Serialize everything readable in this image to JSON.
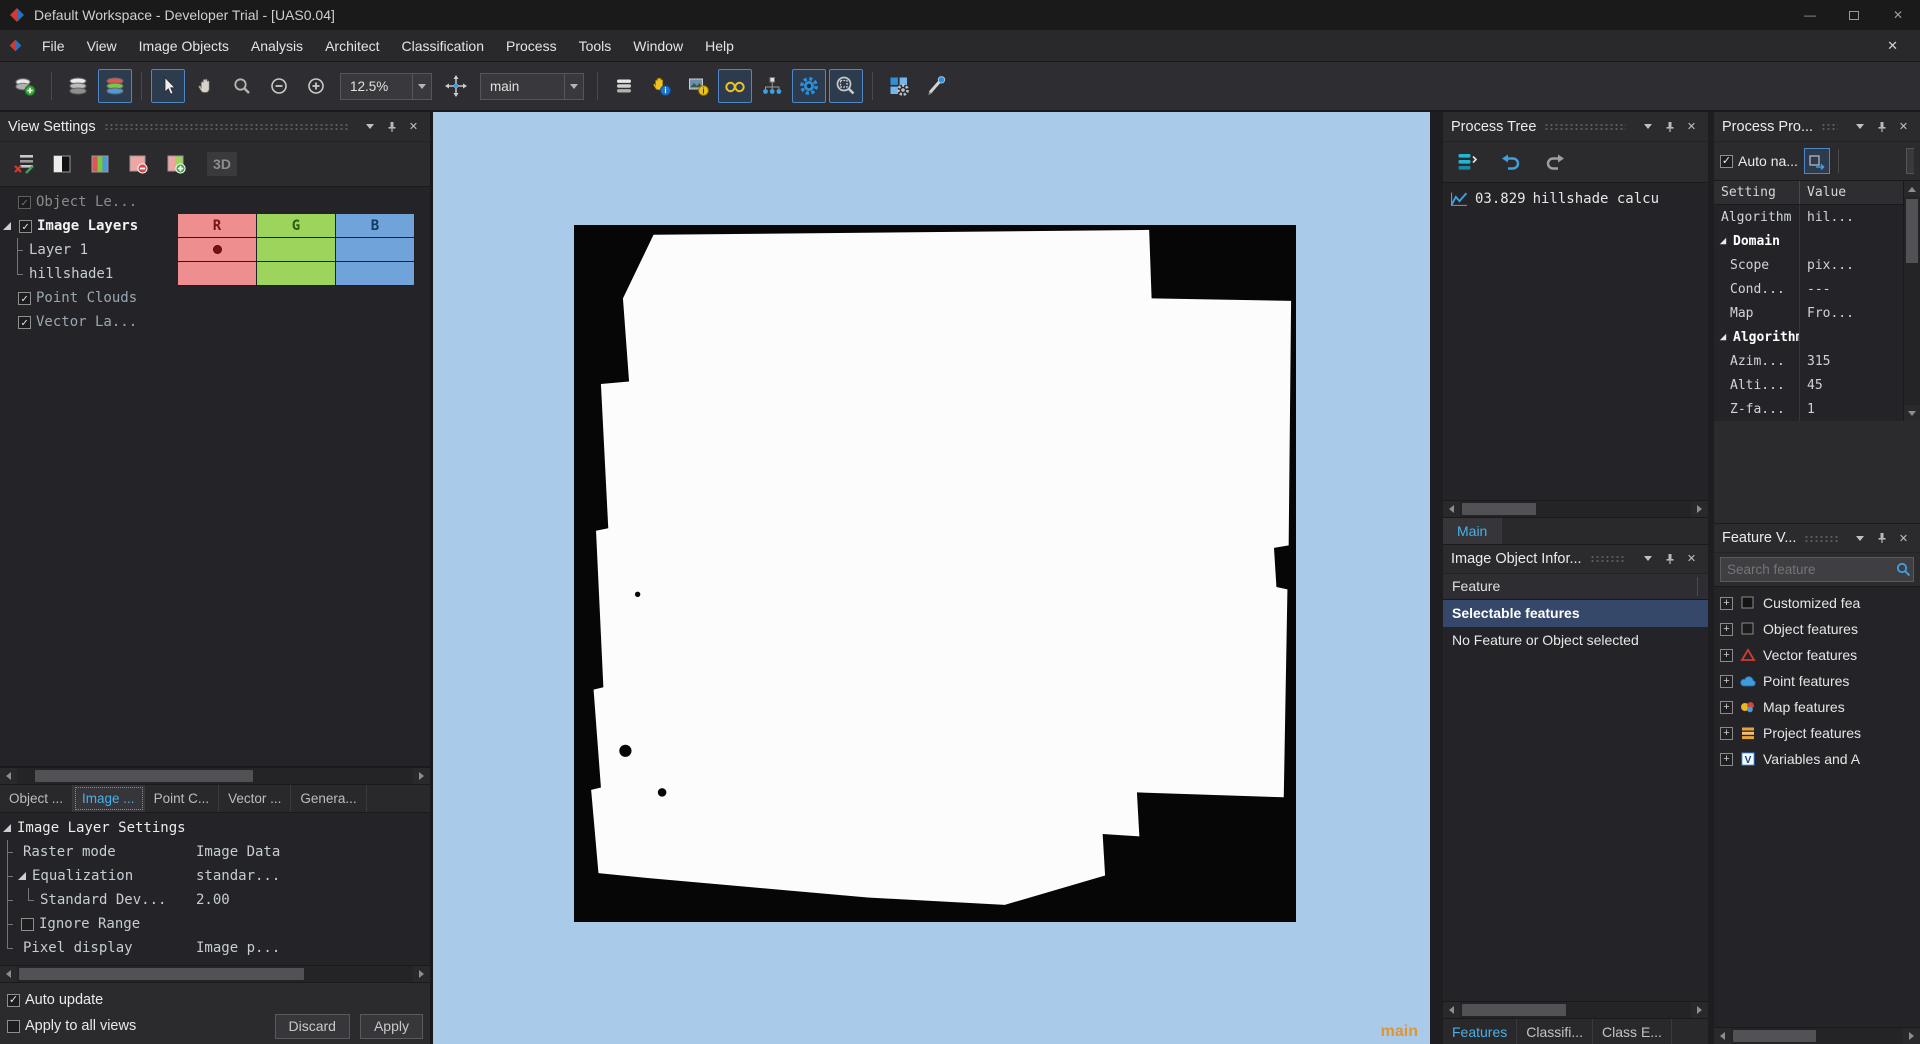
{
  "window": {
    "title": "Default Workspace - Developer Trial - [UAS0.04]"
  },
  "menu": {
    "items": [
      "File",
      "View",
      "Image Objects",
      "Analysis",
      "Architect",
      "Classification",
      "Process",
      "Tools",
      "Window",
      "Help"
    ]
  },
  "toolbar": {
    "zoom_value": "12.5%",
    "map_select": "main"
  },
  "view_settings": {
    "title": "View Settings",
    "threed_label": "3D",
    "rows": {
      "object_levels": "Object Le...",
      "image_layers": "Image Layers",
      "layer1": "Layer 1",
      "hillshade": "hillshade1",
      "point_clouds": "Point Clouds",
      "vector_layers": "Vector La..."
    },
    "band_columns": [
      "R",
      "G",
      "B"
    ],
    "tabs": [
      "Object ...",
      "Image ...",
      "Point C...",
      "Vector ...",
      "Genera..."
    ],
    "settings": {
      "header": "Image Layer Settings",
      "rows": [
        {
          "name": "Raster mode",
          "value": "Image Data"
        },
        {
          "name": "Equalization",
          "value": "standar..."
        },
        {
          "name": "Standard Dev...",
          "value": "2.00"
        },
        {
          "name": "Ignore Range",
          "value": ""
        },
        {
          "name": "Pixel display",
          "value": "Image p..."
        }
      ]
    },
    "auto_update_label": "Auto update",
    "apply_all_label": "Apply to all views",
    "discard_label": "Discard",
    "apply_label": "Apply"
  },
  "map_view": {
    "label": "main"
  },
  "process_tree": {
    "title": "Process Tree",
    "item": {
      "time": "03.829",
      "name": "hillshade calcu"
    },
    "tab": "Main"
  },
  "image_object_info": {
    "title": "Image Object Infor...",
    "column_header": "Feature",
    "row1": "Selectable features",
    "row2": "No Feature or Object selected",
    "tabs": [
      "Features",
      "Classifi...",
      "Class E..."
    ]
  },
  "process_properties": {
    "title": "Process Pro...",
    "auto_name_label": "Auto na...",
    "col_setting": "Setting",
    "col_value": "Value",
    "rows": [
      {
        "name": "Algorithm",
        "value": "hil..."
      },
      {
        "name": "Domain",
        "value": ""
      },
      {
        "name": "Scope",
        "value": "pix..."
      },
      {
        "name": "Cond...",
        "value": "---"
      },
      {
        "name": "Map",
        "value": "Fro..."
      },
      {
        "name": "Algorithm ...",
        "value": ""
      },
      {
        "name": "Azim...",
        "value": "315"
      },
      {
        "name": "Alti...",
        "value": "45"
      },
      {
        "name": "Z-fa...",
        "value": "1"
      }
    ]
  },
  "feature_view": {
    "title": "Feature V...",
    "search_placeholder": "Search feature",
    "items": [
      "Customized fea",
      "Object features",
      "Vector features",
      "Point features",
      "Map features",
      "Project features",
      "Variables and A"
    ]
  }
}
